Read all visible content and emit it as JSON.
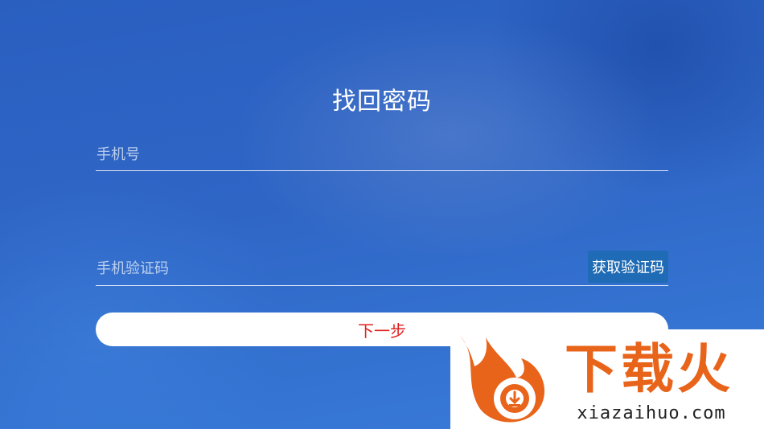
{
  "page": {
    "title": "找回密码"
  },
  "form": {
    "phone_placeholder": "手机号",
    "code_placeholder": "手机验证码",
    "get_code_label": "获取验证码",
    "next_label": "下一步"
  },
  "watermark": {
    "brand": "下载火",
    "domain": "xiazaihuo.com"
  },
  "colors": {
    "background": "#2f66c6",
    "code_button": "#1f6bb5",
    "next_text": "#e02020",
    "watermark_orange": "#e8641a"
  }
}
